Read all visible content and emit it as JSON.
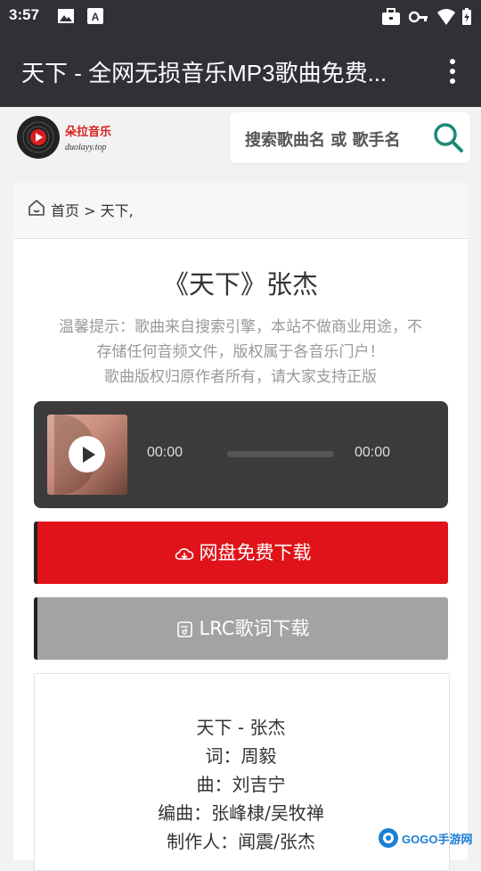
{
  "status_bar": {
    "time": "3:57"
  },
  "app_bar": {
    "title": "天下 - 全网无损音乐MP3歌曲免费..."
  },
  "site": {
    "logo_name": "朵拉音乐",
    "logo_domain": "duolayy.top",
    "search_placeholder": "搜索歌曲名 或 歌手名"
  },
  "breadcrumb": {
    "text": "首页 > 天下,"
  },
  "song": {
    "title": "《天下》张杰",
    "notice_lines": [
      "温馨提示：歌曲来自搜索引擎，本站不做商业用途，不",
      "存储任何音频文件，版权属于各音乐门户！",
      "歌曲版权归原作者所有，请大家支持正版"
    ]
  },
  "player": {
    "current_time": "00:00",
    "total_time": "00:00",
    "progress": 0
  },
  "buttons": {
    "download": "网盘免费下载",
    "lrc": "LRC歌词下载"
  },
  "lyrics": [
    "天下 - 张杰",
    "词：周毅",
    "曲：刘吉宁",
    "编曲：张峰棣/吴牧禅",
    "制作人：闻震/张杰"
  ],
  "watermark": {
    "text": "GOGO手游网"
  },
  "colors": {
    "bar": "#303036",
    "download_red": "#e0121a",
    "lrc_gray": "#a3a3a3",
    "search_icon": "#1a8a78"
  }
}
